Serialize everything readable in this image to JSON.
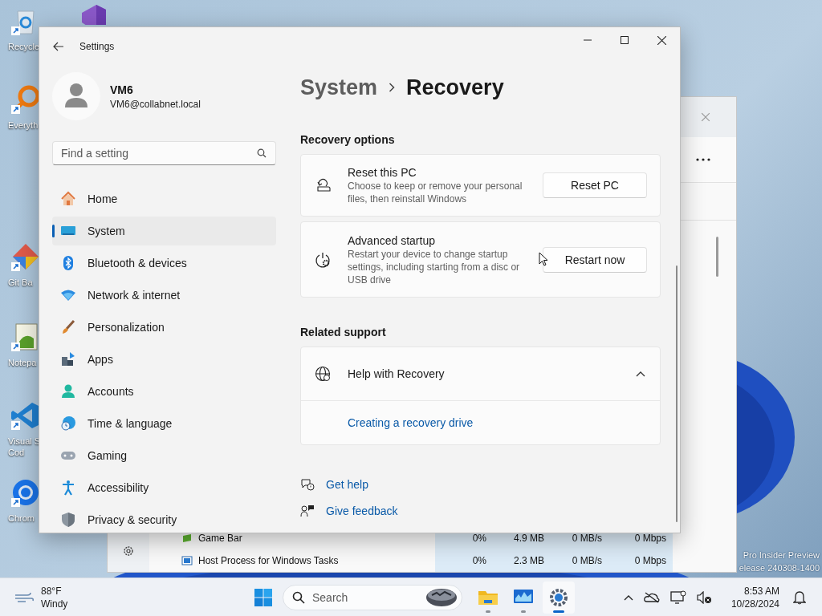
{
  "desktop": {
    "icons": [
      {
        "kind": "recycle",
        "lines": [
          "Recycle"
        ]
      },
      {
        "kind": "studio"
      },
      {
        "kind": "search",
        "lines": [
          "Everyth"
        ]
      },
      {
        "kind": "git",
        "lines": [
          "Git Ba"
        ]
      },
      {
        "kind": "notepad",
        "lines": [
          "Notepa"
        ]
      },
      {
        "kind": "code",
        "lines": [
          "Visual S",
          "Cod"
        ]
      },
      {
        "kind": "browser",
        "lines": [
          "Chrom"
        ]
      }
    ],
    "watermark": [
      "Pro Insider Preview",
      "elease 240308-1400"
    ]
  },
  "task_manager": {
    "rows": [
      {
        "kind": "game",
        "name": "Game Bar",
        "cpu": "0%",
        "memory": "4.9 MB",
        "disk": "0 MB/s",
        "network": "0 Mbps"
      },
      {
        "kind": "window",
        "name": "Host Process for Windows Tasks",
        "cpu": "0%",
        "memory": "2.3 MB",
        "disk": "0 MB/s",
        "network": "0 Mbps"
      }
    ]
  },
  "settings": {
    "title": "Settings",
    "user": {
      "name": "VM6",
      "email": "VM6@collabnet.local"
    },
    "search": {
      "placeholder": "Find a setting"
    },
    "nav": [
      {
        "kind": "home",
        "label": "Home",
        "selected": false
      },
      {
        "kind": "system",
        "label": "System",
        "selected": true
      },
      {
        "kind": "bluetooth",
        "label": "Bluetooth & devices",
        "selected": false
      },
      {
        "kind": "network",
        "label": "Network & internet",
        "selected": false
      },
      {
        "kind": "brush",
        "label": "Personalization",
        "selected": false
      },
      {
        "kind": "apps",
        "label": "Apps",
        "selected": false
      },
      {
        "kind": "accounts",
        "label": "Accounts",
        "selected": false
      },
      {
        "kind": "time",
        "label": "Time & language",
        "selected": false
      },
      {
        "kind": "gaming",
        "label": "Gaming",
        "selected": false
      },
      {
        "kind": "accessibility",
        "label": "Accessibility",
        "selected": false
      },
      {
        "kind": "privacy",
        "label": "Privacy & security",
        "selected": false
      }
    ],
    "breadcrumb": {
      "parent": "System",
      "current": "Recovery"
    },
    "recovery_options": {
      "heading": "Recovery options",
      "cards": [
        {
          "kind": "reset",
          "title": "Reset this PC",
          "description": "Choose to keep or remove your personal files, then reinstall Windows",
          "button": "Reset PC"
        },
        {
          "kind": "startup",
          "title": "Advanced startup",
          "description": "Restart your device to change startup settings, including starting from a disc or USB drive",
          "button": "Restart now"
        }
      ]
    },
    "related_support": {
      "heading": "Related support",
      "expander": {
        "title": "Help with Recovery",
        "expanded": true,
        "link": "Creating a recovery drive"
      }
    },
    "footer_links": [
      {
        "kind": "help",
        "label": "Get help"
      },
      {
        "kind": "feedback",
        "label": "Give feedback"
      }
    ]
  },
  "taskbar": {
    "weather": {
      "temperature": "88°F",
      "condition": "Windy"
    },
    "search": {
      "placeholder": "Search"
    },
    "apps": [
      {
        "kind": "folder",
        "selected": false
      },
      {
        "kind": "monitor",
        "selected": false
      },
      {
        "kind": "gear",
        "selected": true
      }
    ],
    "clock": {
      "time": "8:53 AM",
      "date": "10/28/2024"
    }
  }
}
